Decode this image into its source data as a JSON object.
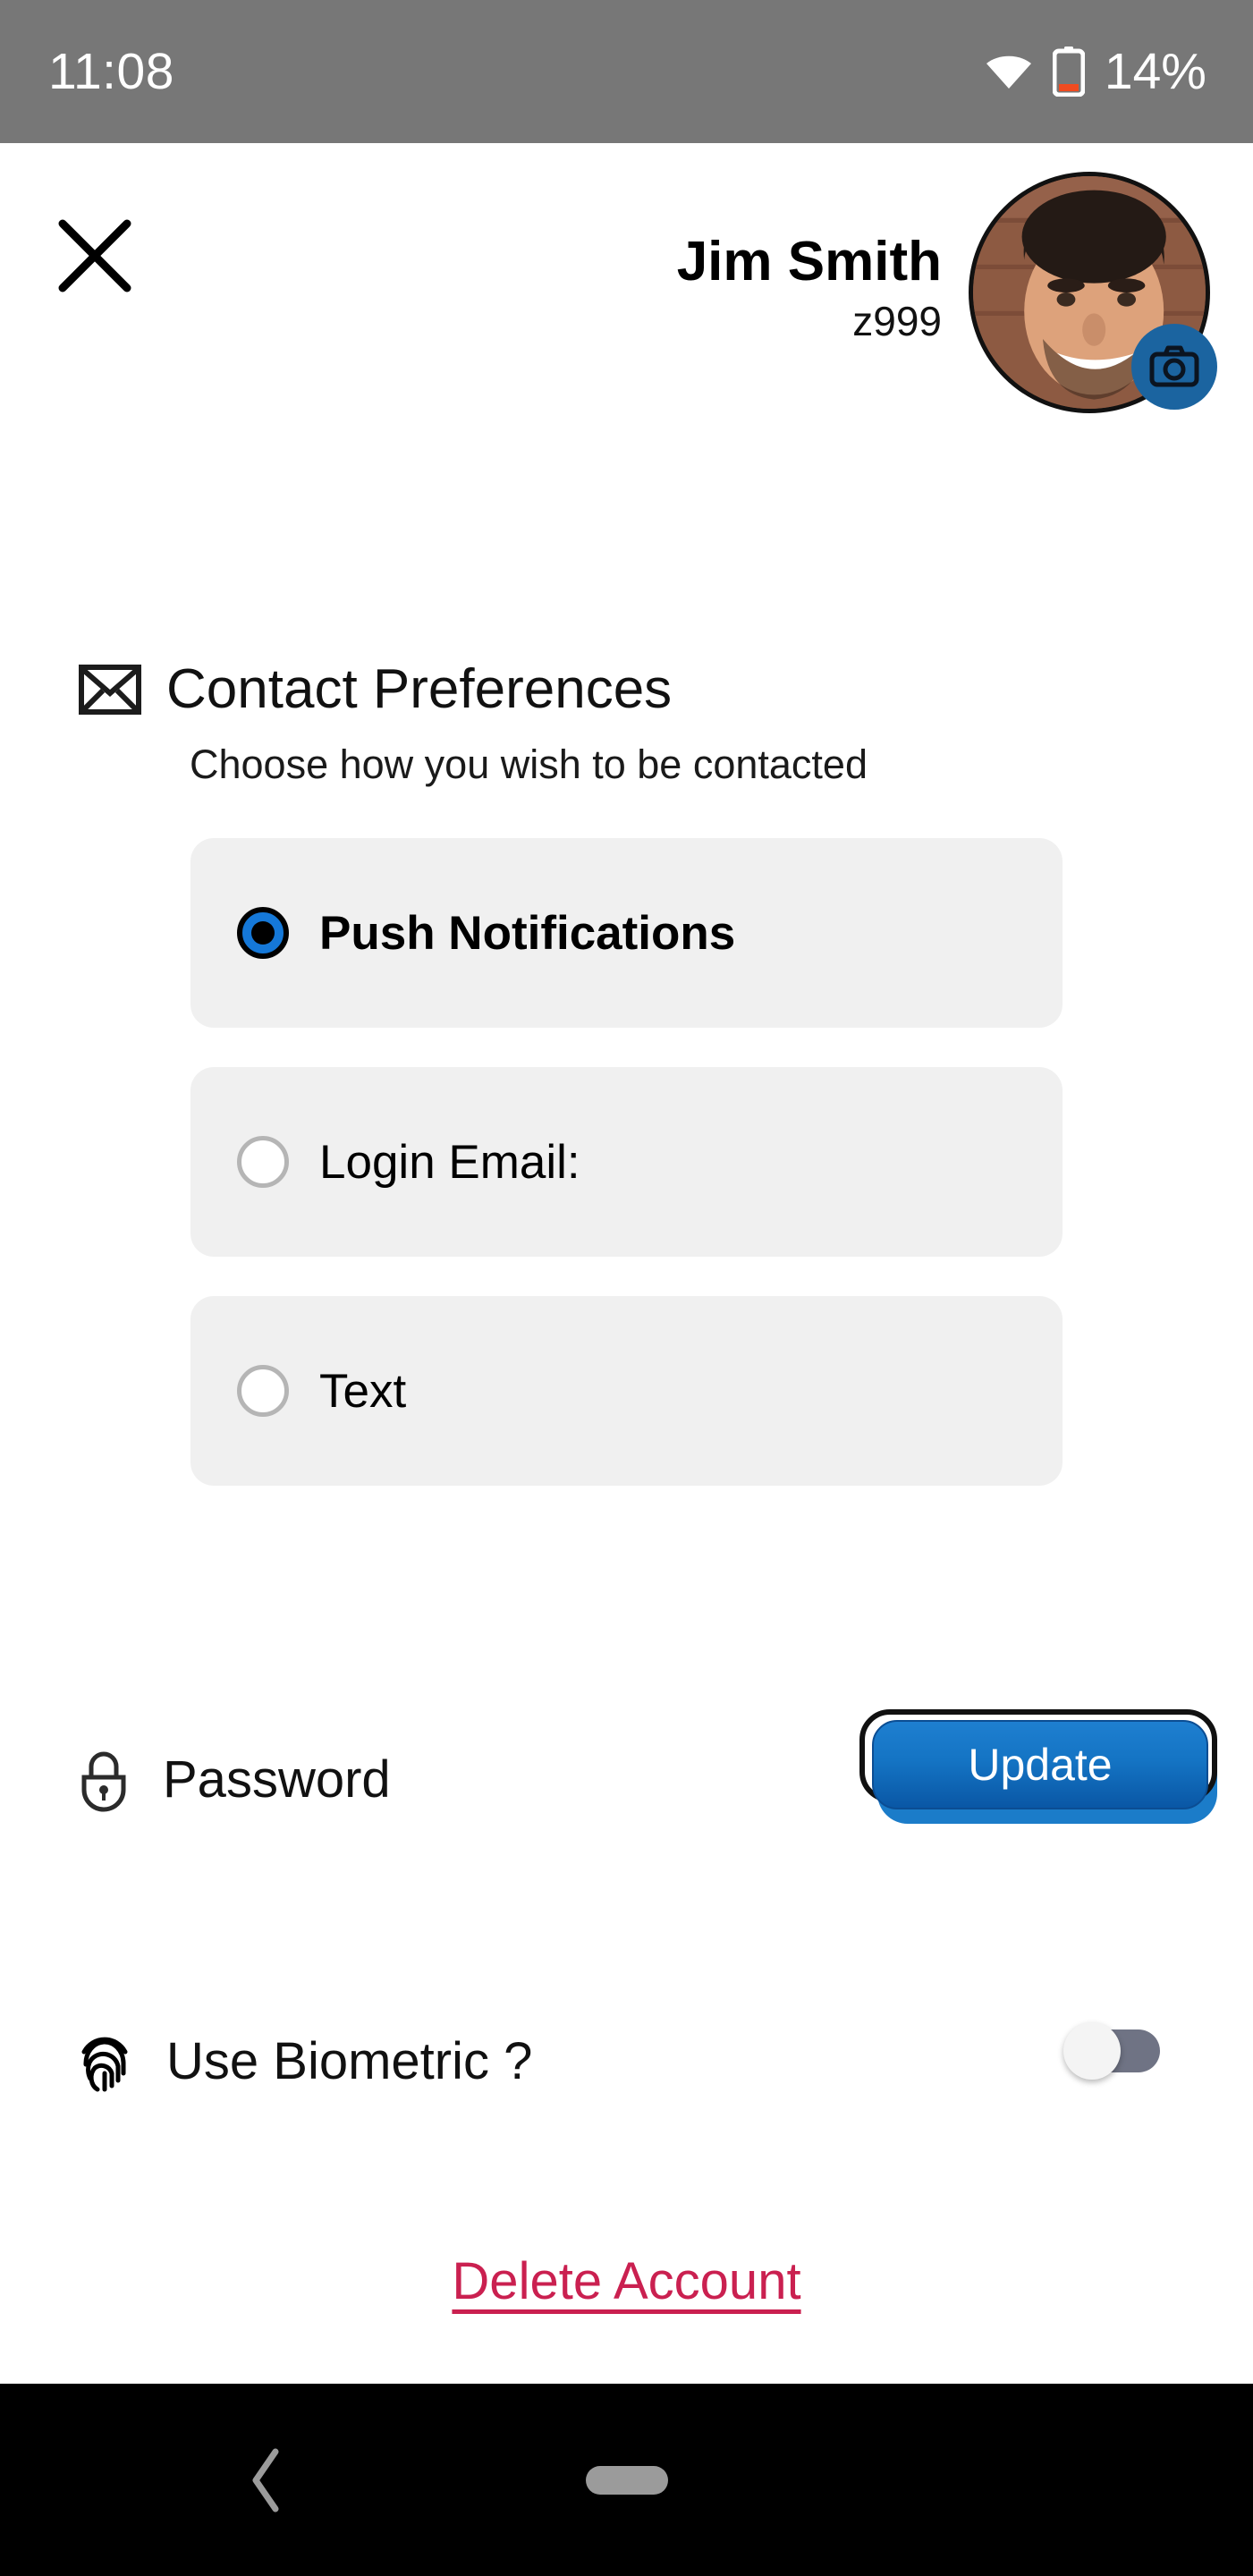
{
  "status_bar": {
    "time": "11:08",
    "battery_percent": "14%",
    "wifi_icon": "wifi-icon",
    "battery_icon": "battery-low-icon",
    "background_color": "#777777",
    "battery_level_color": "#f04b20"
  },
  "header": {
    "close_icon": "close-icon",
    "user_name": "Jim Smith",
    "user_id": "z999",
    "avatar_name": "avatar",
    "camera_badge_icon": "camera-icon",
    "camera_badge_color": "#1b64a0"
  },
  "contact_preferences": {
    "icon": "envelope-icon",
    "title": "Contact Preferences",
    "subtitle": "Choose how you wish to be contacted",
    "selected_value": "Push Notifications",
    "options": [
      {
        "label": "Push Notifications",
        "selected": true
      },
      {
        "label": "Login Email:",
        "selected": false
      },
      {
        "label": "Text",
        "selected": false
      }
    ],
    "card_background": "#f0f0f0",
    "selected_radio_color": "#1578d8"
  },
  "password": {
    "icon": "lock-icon",
    "label": "Password",
    "button_label": "Update",
    "button_color": "#1474c4"
  },
  "biometric": {
    "icon": "fingerprint-icon",
    "label": "Use Biometric ?",
    "toggle_state": "off",
    "track_color": "#6f7384",
    "knob_color": "#f4f4f4"
  },
  "delete_account": {
    "label": "Delete Account",
    "color": "#ca2050"
  },
  "nav_bar": {
    "back_icon": "back-chevron-icon",
    "home_icon": "home-pill-icon",
    "background_color": "#000000"
  }
}
